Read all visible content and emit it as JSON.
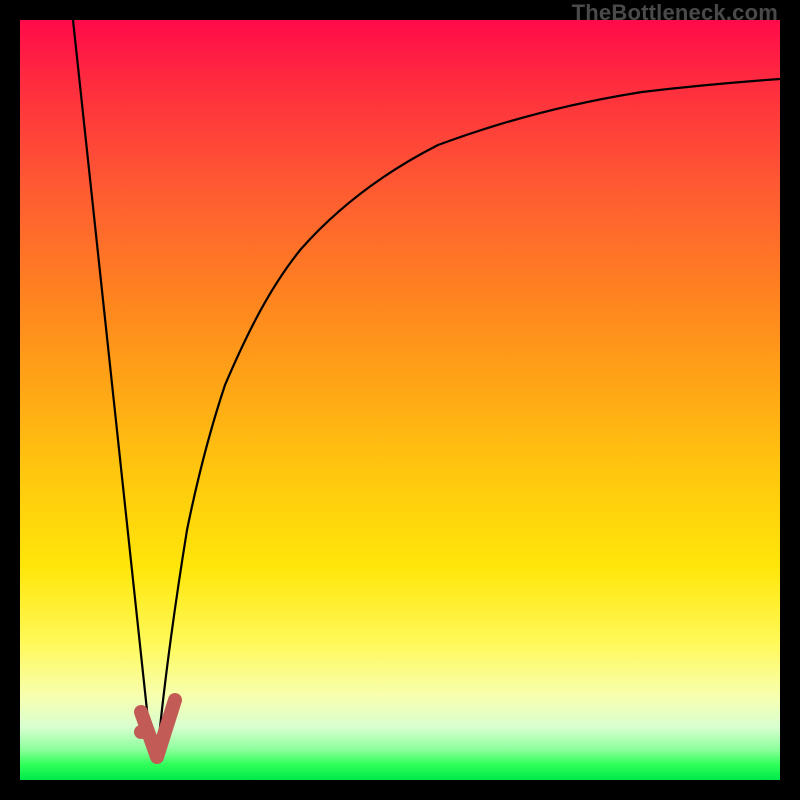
{
  "watermark": {
    "text": "TheBottleneck.com"
  },
  "chart_data": {
    "type": "line",
    "title": "",
    "xlabel": "",
    "ylabel": "",
    "xlim": [
      0,
      100
    ],
    "ylim": [
      0,
      100
    ],
    "grid": false,
    "series": [
      {
        "name": "left-branch",
        "x": [
          7,
          17.4
        ],
        "values": [
          100,
          3
        ]
      },
      {
        "name": "right-branch",
        "x": [
          18.0,
          19.1,
          20.5,
          22.0,
          23.5,
          25.0,
          27.0,
          30.0,
          33.0,
          37.0,
          42.0,
          48.0,
          55.0,
          63.0,
          72.0,
          82.0,
          91.0,
          100.0
        ],
        "values": [
          3.0,
          14.0,
          24.0,
          33.0,
          40.0,
          46.0,
          52.0,
          59.0,
          65.0,
          70.5,
          75.5,
          80.0,
          83.5,
          86.5,
          88.8,
          90.6,
          91.6,
          92.2
        ]
      }
    ],
    "marker": {
      "name": "dot-marker",
      "x": 15.9,
      "y": 6.3,
      "color": "#c25a55",
      "radius_px": 7
    },
    "checkmark": {
      "name": "check-marker",
      "color": "#c25a55",
      "stroke_px": 14,
      "points_xy": [
        [
          15.9,
          8.9
        ],
        [
          18.0,
          3.0
        ],
        [
          20.4,
          10.5
        ]
      ]
    },
    "background_gradient": {
      "top": "#ff0a4a",
      "mid_upper": "#ff8220",
      "mid": "#ffe60a",
      "lower": "#f7ffb0",
      "bottom": "#00e84c"
    }
  }
}
